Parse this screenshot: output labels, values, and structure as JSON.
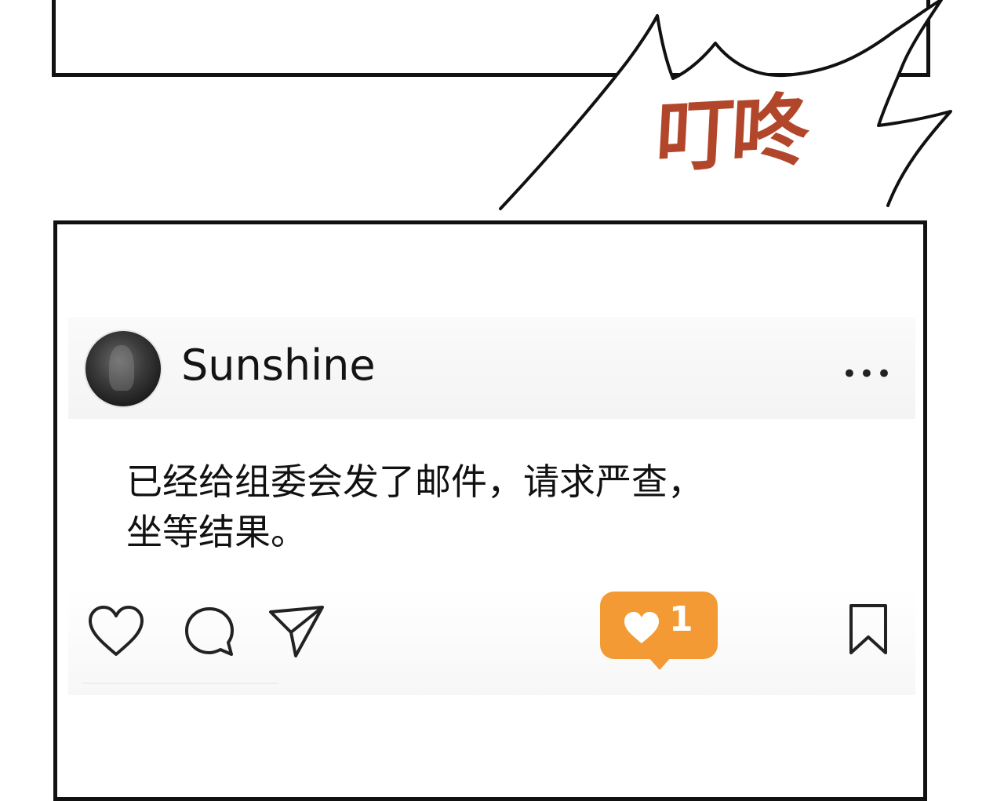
{
  "sound_effect": "叮咚",
  "post": {
    "username": "Sunshine",
    "more_label": "•••",
    "text": "已经给组委会发了邮件，请求严查，\n坐等结果。",
    "notification": {
      "count": "1",
      "color": "#f39a34"
    }
  },
  "icons": {
    "avatar": "avatar",
    "more": "more-icon",
    "like": "heart-icon",
    "comment": "comment-icon",
    "share": "send-icon",
    "notification": "heart-notification-icon",
    "save": "bookmark-icon"
  },
  "colors": {
    "sfx": "#b2462b",
    "notification": "#f39a34",
    "ink": "#111111"
  }
}
